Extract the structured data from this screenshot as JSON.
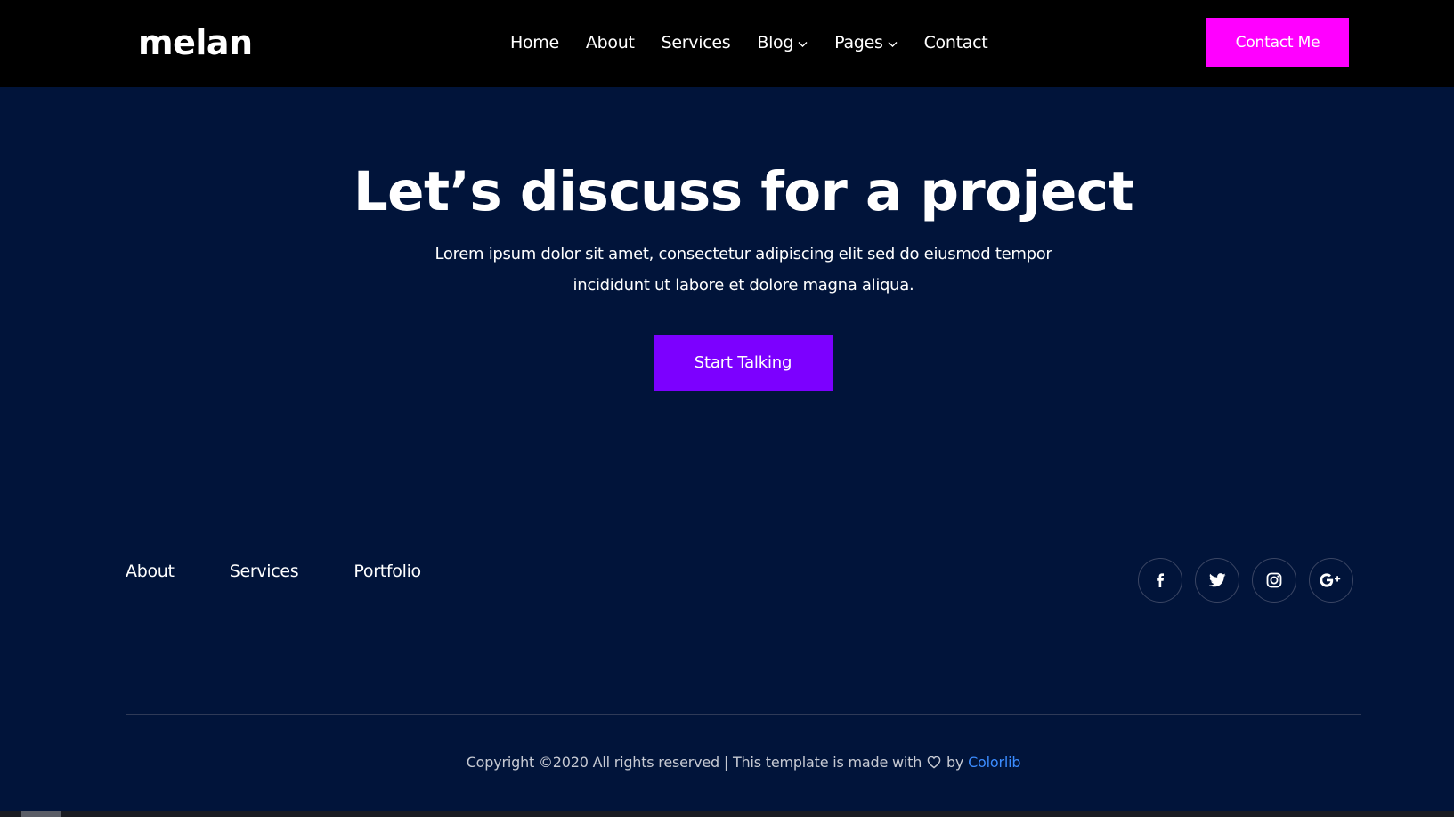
{
  "brand": {
    "logo": "melan"
  },
  "nav": {
    "items": [
      {
        "label": "Home",
        "has_dropdown": false
      },
      {
        "label": "About",
        "has_dropdown": false
      },
      {
        "label": "Services",
        "has_dropdown": false
      },
      {
        "label": "Blog",
        "has_dropdown": true
      },
      {
        "label": "Pages",
        "has_dropdown": true
      },
      {
        "label": "Contact",
        "has_dropdown": false
      }
    ],
    "cta_label": "Contact Me"
  },
  "hero": {
    "title": "Let’s discuss for a project",
    "text": "Lorem ipsum dolor sit amet, consectetur adipiscing elit sed do eiusmod tempor incididunt ut labore et dolore magna aliqua.",
    "button_label": "Start Talking"
  },
  "footer": {
    "links": [
      {
        "label": "About"
      },
      {
        "label": "Services"
      },
      {
        "label": "Portfolio"
      }
    ],
    "socials": [
      {
        "icon": "facebook-icon"
      },
      {
        "icon": "twitter-icon"
      },
      {
        "icon": "instagram-icon"
      },
      {
        "icon": "google-plus-icon"
      }
    ],
    "copyright_prefix": "Copyright ©2020 All rights reserved | This template is made with",
    "copyright_by": "by",
    "credit_link": "Colorlib"
  },
  "colors": {
    "header_bg": "#000000",
    "page_bg": "#01143a",
    "contact_button": "#ff00ff",
    "start_button": "#7c00ff",
    "credit_link": "#3b8cff"
  }
}
